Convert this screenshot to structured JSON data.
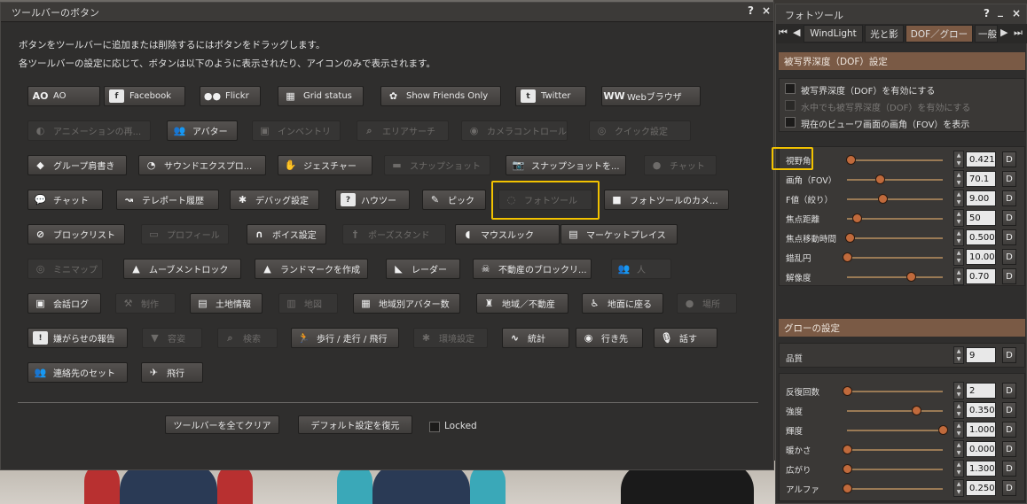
{
  "toolbar_panel": {
    "title": "ツールバーのボタン",
    "help": "?",
    "close": "×",
    "desc1": "ボタンをツールバーに追加または削除するにはボタンをドラッグします。",
    "desc2": "各ツールバーの設定に応じて、ボタンは以下のように表示されたり、アイコンのみで表示されます。",
    "buttons": [
      {
        "label": "AO",
        "icon": "AO",
        "disabled": false
      },
      {
        "label": "Facebook",
        "icon": "f",
        "disabled": false
      },
      {
        "label": "Flickr",
        "icon": "●●",
        "disabled": false
      },
      {
        "label": "Grid status",
        "icon": "▦",
        "disabled": false
      },
      {
        "label": "Show Friends Only",
        "icon": "✿",
        "disabled": false
      },
      {
        "label": "Twitter",
        "icon": "t",
        "disabled": false
      },
      {
        "label": "Webブラウザ",
        "icon": "WW",
        "disabled": false
      },
      {
        "label": "アニメーションの再...",
        "icon": "◐",
        "disabled": true
      },
      {
        "label": "アバター",
        "icon": "👥",
        "disabled": false
      },
      {
        "label": "インベントリ",
        "icon": "▣",
        "disabled": true
      },
      {
        "label": "エリアサーチ",
        "icon": "⌕",
        "disabled": true
      },
      {
        "label": "カメラコントロール",
        "icon": "◉",
        "disabled": true
      },
      {
        "label": "クイック設定",
        "icon": "◎",
        "disabled": true
      },
      {
        "label": "グループ肩書き",
        "icon": "◆",
        "disabled": false
      },
      {
        "label": "サウンドエクスプロ...",
        "icon": "◔",
        "disabled": false
      },
      {
        "label": "ジェスチャー",
        "icon": "✋",
        "disabled": false
      },
      {
        "label": "スナップショット",
        "icon": "▬",
        "disabled": true
      },
      {
        "label": "スナップショットを...",
        "icon": "📷",
        "disabled": false
      },
      {
        "label": "チャット",
        "icon": "●",
        "disabled": true
      },
      {
        "label": "チャット",
        "icon": "💬",
        "disabled": false
      },
      {
        "label": "テレポート履歴",
        "icon": "↝",
        "disabled": false
      },
      {
        "label": "デバッグ設定",
        "icon": "✱",
        "disabled": false
      },
      {
        "label": "ハウツー",
        "icon": "?",
        "disabled": false
      },
      {
        "label": "ピック",
        "icon": "✎",
        "disabled": false
      },
      {
        "label": "フォトツール",
        "icon": "◌",
        "disabled": true
      },
      {
        "label": "フォトツールのカメ...",
        "icon": "■",
        "disabled": false
      },
      {
        "label": "ブロックリスト",
        "icon": "⊘",
        "disabled": false
      },
      {
        "label": "プロフィール",
        "icon": "▭",
        "disabled": true
      },
      {
        "label": "ボイス設定",
        "icon": "∩",
        "disabled": false
      },
      {
        "label": "ポーズスタンド",
        "icon": "†",
        "disabled": true
      },
      {
        "label": "マウスルック",
        "icon": "◖",
        "disabled": false
      },
      {
        "label": "マーケットプレイス",
        "icon": "▤",
        "disabled": false
      },
      {
        "label": "ミニマップ",
        "icon": "◎",
        "disabled": true
      },
      {
        "label": "ムーブメントロック",
        "icon": "▲",
        "disabled": false
      },
      {
        "label": "ランドマークを作成",
        "icon": "▲",
        "disabled": false
      },
      {
        "label": "レーダー",
        "icon": "◣",
        "disabled": false
      },
      {
        "label": "不動産のブロックリ...",
        "icon": "☠",
        "disabled": false
      },
      {
        "label": "人",
        "icon": "👥",
        "disabled": true
      },
      {
        "label": "会話ログ",
        "icon": "▣",
        "disabled": false
      },
      {
        "label": "制作",
        "icon": "⚒",
        "disabled": true
      },
      {
        "label": "土地情報",
        "icon": "▤",
        "disabled": false
      },
      {
        "label": "地図",
        "icon": "▥",
        "disabled": true
      },
      {
        "label": "地域別アバター数",
        "icon": "▦",
        "disabled": false
      },
      {
        "label": "地域／不動産",
        "icon": "♜",
        "disabled": false
      },
      {
        "label": "地面に座る",
        "icon": "♿",
        "disabled": false
      },
      {
        "label": "場所",
        "icon": "●",
        "disabled": true
      },
      {
        "label": "嫌がらせの報告",
        "icon": "!",
        "disabled": false
      },
      {
        "label": "容姿",
        "icon": "▼",
        "disabled": true
      },
      {
        "label": "検索",
        "icon": "⌕",
        "disabled": true
      },
      {
        "label": "歩行 / 走行 / 飛行",
        "icon": "🏃",
        "disabled": false
      },
      {
        "label": "環境設定",
        "icon": "✱",
        "disabled": true
      },
      {
        "label": "統計",
        "icon": "∿",
        "disabled": false
      },
      {
        "label": "行き先",
        "icon": "◉",
        "disabled": false
      },
      {
        "label": "話す",
        "icon": "🎙",
        "disabled": false
      },
      {
        "label": "連絡先のセット",
        "icon": "👥",
        "disabled": false
      },
      {
        "label": "飛行",
        "icon": "✈",
        "disabled": false
      }
    ],
    "clear_button": "ツールバーを全てクリア",
    "restore_button": "デフォルト設定を復元",
    "locked_label": "Locked"
  },
  "photo_tools": {
    "title": "フォトツール",
    "help": "?",
    "minimize": "_",
    "close": "×",
    "tabs": [
      "WindLight",
      "光と影",
      "DOF／グロー",
      "一般"
    ],
    "active_tab": 2,
    "dof_header": "被写界深度（DOF）設定",
    "dof_checks": [
      {
        "label": "被写界深度（DOF）を有効にする",
        "enabled": true
      },
      {
        "label": "水中でも被写界深度（DOF）を有効にする",
        "enabled": false
      },
      {
        "label": "現在のビューワ画面の画角（FOV）を表示",
        "enabled": true
      }
    ],
    "dof_sliders": [
      {
        "label": "視野角",
        "value": "0.421",
        "fraction": 0.04
      },
      {
        "label": "画角（FOV）",
        "value": "70.1",
        "fraction": 0.34
      },
      {
        "label": "F値（絞り）",
        "value": "9.00",
        "fraction": 0.37
      },
      {
        "label": "焦点距離",
        "value": "50",
        "fraction": 0.1
      },
      {
        "label": "焦点移動時間",
        "value": "0.500",
        "fraction": 0.03
      },
      {
        "label": "錯乱円",
        "value": "10.00",
        "fraction": 0.0
      },
      {
        "label": "解像度",
        "value": "0.70",
        "fraction": 0.67
      }
    ],
    "glow_header": "グローの設定",
    "quality_label": "品質",
    "quality_value": "9",
    "glow_sliders": [
      {
        "label": "反復回数",
        "value": "2",
        "fraction": 0.0
      },
      {
        "label": "強度",
        "value": "0.350",
        "fraction": 0.72
      },
      {
        "label": "輝度",
        "value": "1.000",
        "fraction": 1.0
      },
      {
        "label": "暖かさ",
        "value": "0.000",
        "fraction": 0.0
      },
      {
        "label": "広がり",
        "value": "1.300",
        "fraction": 0.0
      },
      {
        "label": "アルファ",
        "value": "0.250",
        "fraction": 0.0
      }
    ],
    "default_btn": "D"
  },
  "colors": {
    "accent_highlight": "#f2c200",
    "section_header": "#7a5a45",
    "slider_knob": "#c06a3c"
  }
}
